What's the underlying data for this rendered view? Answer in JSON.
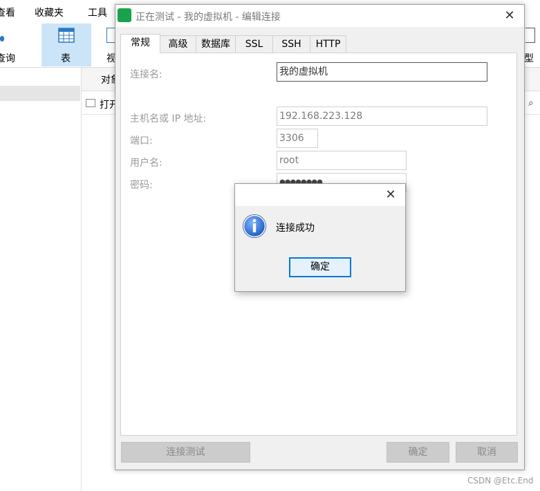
{
  "background_app": {
    "menu": [
      "查看",
      "收藏夹",
      "工具"
    ],
    "ribbon": {
      "query_label": "查询",
      "table_label": "表",
      "view_label": "视",
      "right_tail_label": "型"
    },
    "tab_partial": "对象",
    "toolbar_partial": "打开"
  },
  "dialog": {
    "title": "正在测试 - 我的虚拟机 - 编辑连接",
    "tabs": [
      "常规",
      "高级",
      "数据库",
      "SSL",
      "SSH",
      "HTTP"
    ],
    "active_tab": "常规",
    "fields": {
      "connection_name": {
        "label": "连接名:",
        "value": "我的虚拟机"
      },
      "host": {
        "label": "主机名或 IP 地址:",
        "value": "192.168.223.128"
      },
      "port": {
        "label": "端口:",
        "value": "3306"
      },
      "username": {
        "label": "用户名:",
        "value": "root"
      },
      "password": {
        "label": "密码:",
        "value": "●●●●●●●●"
      }
    },
    "buttons": {
      "test": "连接测试",
      "ok": "确定",
      "cancel": "取消"
    }
  },
  "message_box": {
    "text": "连接成功",
    "ok_label": "确定",
    "icon": "info-icon"
  },
  "watermark": "CSDN @Etc.End",
  "colors": {
    "selected_ribbon": "#cce4f7",
    "ok_focus_border": "#0078d7",
    "app_icon_green": "#1aa34a",
    "info_icon_blue": "#1f5fbf"
  }
}
